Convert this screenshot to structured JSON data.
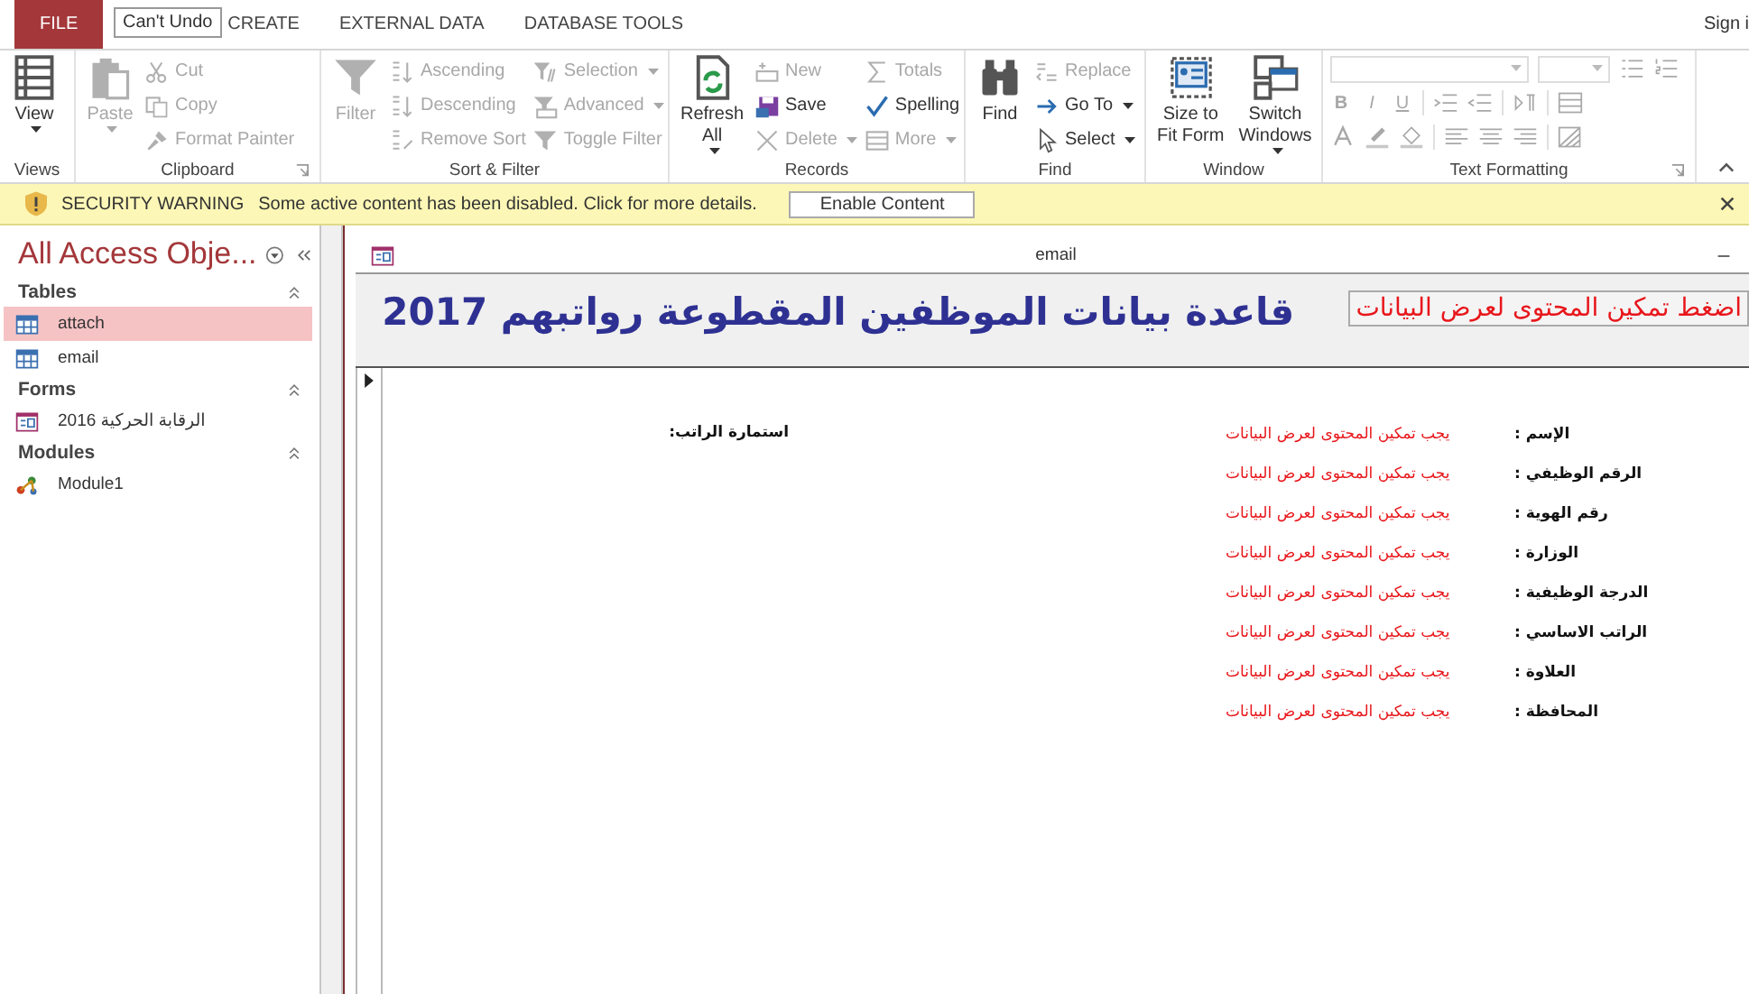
{
  "tabs": [
    {
      "label": "FILE",
      "kind": "file"
    },
    {
      "label": "CREATE",
      "kind": "tab"
    },
    {
      "label": "EXTERNAL DATA",
      "kind": "tab"
    },
    {
      "label": "DATABASE TOOLS",
      "kind": "tab"
    }
  ],
  "tooltip": "Can't Undo",
  "sign_in": "Sign i",
  "ribbon": {
    "groups": [
      {
        "label": "Views",
        "kind": "buttons",
        "large": [
          {
            "label": "View",
            "disabled": false,
            "dropdown": true
          }
        ]
      },
      {
        "label": "Clipboard",
        "kind": "buttons",
        "launcher": true,
        "large": [
          {
            "label": "Paste",
            "disabled": true,
            "dropdown": true
          }
        ],
        "columns": [
          [
            {
              "label": "Cut",
              "disabled": true
            },
            {
              "label": "Copy",
              "disabled": true
            },
            {
              "label": "Format Painter",
              "disabled": true
            }
          ]
        ]
      },
      {
        "label": "Sort & Filter",
        "kind": "buttons",
        "large": [
          {
            "label": "Filter",
            "disabled": true
          }
        ],
        "columns": [
          [
            {
              "label": "Ascending",
              "disabled": true
            },
            {
              "label": "Descending",
              "disabled": true
            },
            {
              "label": "Remove Sort",
              "disabled": true
            }
          ],
          [
            {
              "label": "Selection",
              "disabled": true,
              "dropdown": true
            },
            {
              "label": "Advanced",
              "disabled": true,
              "dropdown": true
            },
            {
              "label": "Toggle Filter",
              "disabled": true
            }
          ]
        ]
      },
      {
        "label": "Records",
        "kind": "buttons",
        "large": [
          {
            "label": "Refresh\nAll",
            "disabled": false,
            "dropdown": true
          }
        ],
        "columns": [
          [
            {
              "label": "New",
              "disabled": true
            },
            {
              "label": "Save",
              "disabled": false
            },
            {
              "label": "Delete",
              "disabled": true,
              "dropdown": true
            }
          ],
          [
            {
              "label": "Totals",
              "disabled": true
            },
            {
              "label": "Spelling",
              "disabled": false
            },
            {
              "label": "More",
              "disabled": true,
              "dropdown": true
            }
          ]
        ]
      },
      {
        "label": "Find",
        "kind": "buttons",
        "large": [
          {
            "label": "Find",
            "disabled": false
          }
        ],
        "columns": [
          [
            {
              "label": "Replace",
              "disabled": true
            },
            {
              "label": "Go To",
              "disabled": false,
              "dropdown": true
            },
            {
              "label": "Select",
              "disabled": false,
              "dropdown": true
            }
          ]
        ]
      },
      {
        "label": "Window",
        "kind": "buttons",
        "large": [
          {
            "label": "Size to\nFit Form",
            "disabled": false
          },
          {
            "label": "Switch\nWindows",
            "disabled": false,
            "dropdown": true
          }
        ]
      },
      {
        "label": "Text Formatting",
        "kind": "formatting",
        "launcher": true,
        "format_buttons": [
          "B",
          "I",
          "U"
        ]
      }
    ]
  },
  "security_bar": {
    "title": "SECURITY WARNING",
    "message": "Some active content has been disabled. Click for more details.",
    "button": "Enable Content"
  },
  "nav": {
    "title": "All Access Obje...",
    "sections": [
      {
        "label": "Tables",
        "items": [
          {
            "label": "attach",
            "kind": "table",
            "selected": true
          },
          {
            "label": "email",
            "kind": "table",
            "selected": false
          }
        ]
      },
      {
        "label": "Forms",
        "items": [
          {
            "label": "الرقابة الحركية 2016",
            "kind": "form",
            "selected": false
          }
        ]
      },
      {
        "label": "Modules",
        "items": [
          {
            "label": "Module1",
            "kind": "module",
            "selected": false
          }
        ]
      }
    ]
  },
  "form": {
    "title": "email",
    "header_title": "قاعدة بيانات الموظفين المقطوعة رواتبهم 2017",
    "enable_button": "اضغط تمكين المحتوى لعرض البيانات",
    "side_label": "استمارة الراتب:",
    "fields": [
      {
        "label": "الإسم :",
        "value": "يجب تمكين المحتوى لعرض البيانات"
      },
      {
        "label": "الرقم الوظيفي :",
        "value": "يجب تمكين المحتوى لعرض البيانات"
      },
      {
        "label": "رقم الهوية :",
        "value": "يجب تمكين المحتوى لعرض البيانات"
      },
      {
        "label": "الوزارة :",
        "value": "يجب تمكين المحتوى لعرض البيانات"
      },
      {
        "label": "الدرجة الوظيفية :",
        "value": "يجب تمكين المحتوى لعرض البيانات"
      },
      {
        "label": "الراتب الاساسي :",
        "value": "يجب تمكين المحتوى لعرض البيانات"
      },
      {
        "label": "العلاوة :",
        "value": "يجب تمكين المحتوى لعرض البيانات"
      },
      {
        "label": "المحافظة :",
        "value": "يجب تمكين المحتوى لعرض البيانات"
      }
    ]
  }
}
